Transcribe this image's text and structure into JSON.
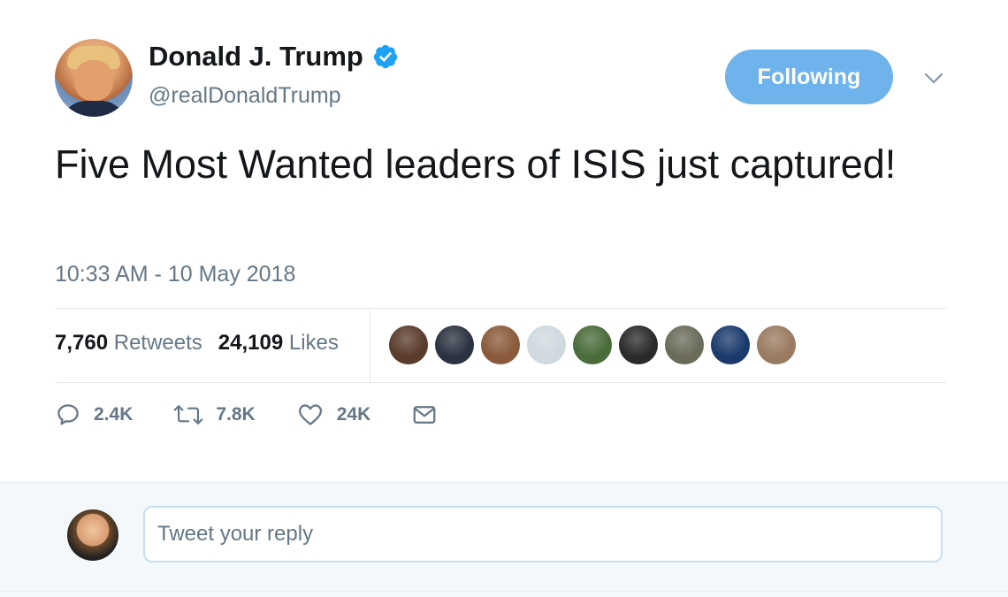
{
  "author": {
    "display_name": "Donald J. Trump",
    "handle": "@realDonaldTrump",
    "verified": true
  },
  "follow_button": {
    "label": "Following"
  },
  "tweet": {
    "text": "Five Most Wanted leaders of ISIS just captured!",
    "timestamp": "10:33 AM - 10 May 2018"
  },
  "stats": {
    "retweets_count": "7,760",
    "retweets_label": "Retweets",
    "likes_count": "24,109",
    "likes_label": "Likes"
  },
  "liker_avatars": [
    {
      "color": "#5a3b2c"
    },
    {
      "color": "#2b3240"
    },
    {
      "color": "#8a5a3a"
    },
    {
      "color": "#cfd9de"
    },
    {
      "color": "#4a6b3a"
    },
    {
      "color": "#2a2a2a"
    },
    {
      "color": "#6b6b5a"
    },
    {
      "color": "#1b3a6b"
    },
    {
      "color": "#9a7a60"
    }
  ],
  "actions": {
    "reply_count": "2.4K",
    "retweet_count": "7.8K",
    "like_count": "24K"
  },
  "reply_box": {
    "placeholder": "Tweet your reply"
  },
  "colors": {
    "accent": "#6fb3ec",
    "verified_badge": "#1da1f2",
    "secondary_text": "#657786"
  }
}
